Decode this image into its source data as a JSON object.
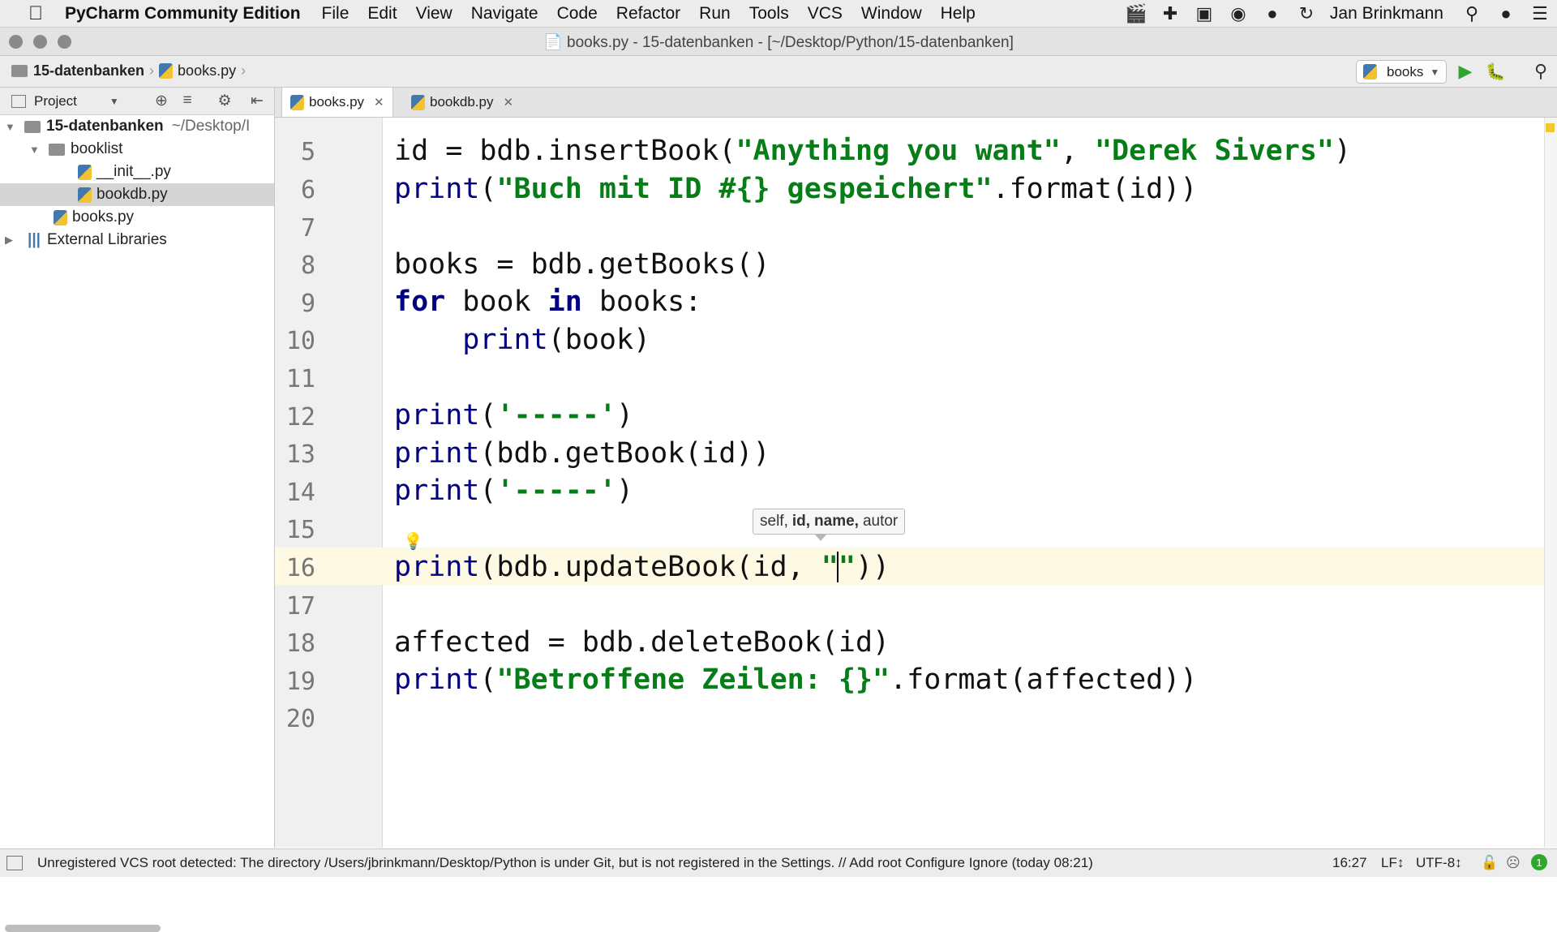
{
  "menubar": {
    "app_name": "PyCharm Community Edition",
    "menus": [
      "File",
      "Edit",
      "View",
      "Navigate",
      "Code",
      "Refactor",
      "Run",
      "Tools",
      "VCS",
      "Window",
      "Help"
    ],
    "user": "Jan Brinkmann"
  },
  "window": {
    "title": "books.py - 15-datenbanken - [~/Desktop/Python/15-datenbanken]"
  },
  "navbar": {
    "breadcrumb": [
      "15-datenbanken",
      "books.py"
    ],
    "run_config": "books"
  },
  "project": {
    "panel_title": "Project",
    "tree": [
      {
        "label": "15-datenbanken",
        "suffix": "~/Desktop/I"
      },
      {
        "label": "booklist"
      },
      {
        "label": "__init__.py"
      },
      {
        "label": "bookdb.py"
      },
      {
        "label": "books.py"
      },
      {
        "label": "External Libraries"
      }
    ]
  },
  "tabs": [
    "books.py",
    "bookdb.py"
  ],
  "editor": {
    "line_numbers": [
      "5",
      "6",
      "7",
      "8",
      "9",
      "10",
      "11",
      "12",
      "13",
      "14",
      "15",
      "16",
      "17",
      "18",
      "19",
      "20"
    ],
    "parameter_hint": {
      "normal": "self,",
      "bold1": "id,",
      "bold2": "name,",
      "normal2": "autor"
    }
  },
  "statusbar": {
    "message": "Unregistered VCS root detected: The directory /Users/jbrinkmann/Desktop/Python is under Git, but is not registered in the Settings. // Add root  Configure  Ignore (today 08:21)",
    "position": "16:27",
    "line_sep": "LF↕",
    "encoding": "UTF-8↕",
    "badge": "1"
  },
  "colors": {
    "keyword": "#000080",
    "string": "#067d17",
    "caret_line": "#fdf9e3",
    "run_green": "#2fa72f"
  }
}
